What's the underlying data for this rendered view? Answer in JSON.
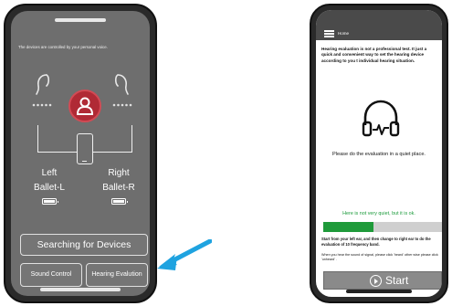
{
  "device_screen": {
    "note": "The devices are controlled by your personal voice.",
    "left": {
      "side": "Left",
      "model": "Ballet-L"
    },
    "right": {
      "side": "Right",
      "model": "Ballet-R"
    },
    "search_button": "Searching for Devices",
    "sound_control_button": "Sound Control",
    "hearing_evaluation_button": "Hearing Evalution"
  },
  "evaluation_screen": {
    "header": {
      "title": "Home"
    },
    "disclaimer": "Hearing evaluation is not a professional test. It just a quick and convenient way to set the hearing device according to you t individual hearing situation.",
    "instruction": "Please do the evaluation in a quiet place.",
    "noise_status": "Here is not very quiet, but it is ok.",
    "noise_level": 0.42,
    "steps_text": "Start from your left ear, and then change to right ear to do the evaluation of 10 frequency band.",
    "signal_text": "When you hear the sound of signal, please click 'heard' other wise please click 'unheard' .",
    "start_button": "Start"
  },
  "colors": {
    "avatar": "#b02a35",
    "arrow": "#1fa3e0",
    "progress": "#1f9a3a",
    "status_text": "#1a9a3a"
  },
  "icons": [
    "hearing-aid-icon",
    "user-icon",
    "smartphone-icon",
    "battery-icon",
    "menu-icon",
    "headphones-icon",
    "play-circle-icon"
  ]
}
